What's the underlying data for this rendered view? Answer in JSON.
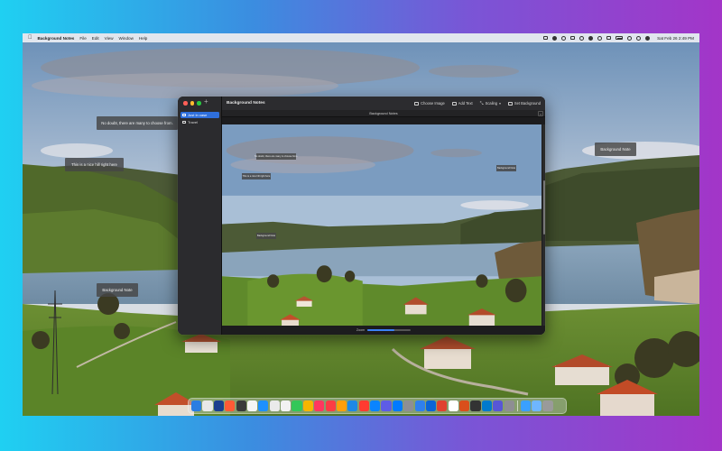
{
  "menubar": {
    "app_name": "Background Notes",
    "menus": [
      "File",
      "Edit",
      "View",
      "Window",
      "Help"
    ],
    "clock": "Sat Feb 26  2:49 PM"
  },
  "desktop_notes": [
    {
      "text": "No doubt, there are many to choose from."
    },
    {
      "text": "This is a nice hill right here"
    },
    {
      "text": "Background Note"
    },
    {
      "text": "Background Note"
    }
  ],
  "window": {
    "title": "Background Notes",
    "add_label": "+",
    "toolbar": {
      "choose_image": "Choose Image",
      "add_text": "Add Text",
      "scaling": "Scaling",
      "set_background": "Set Background"
    },
    "tab_title": "Background Notes",
    "tab_close": "×",
    "sidebar_items": [
      {
        "label": "Just In case",
        "active": true
      },
      {
        "label": "Travel",
        "active": false
      }
    ],
    "inner_notes": [
      {
        "text": "No doubt, there are many to choose from."
      },
      {
        "text": "This is a nice hill right here"
      },
      {
        "text": "Background Note"
      },
      {
        "text": "Background Note"
      }
    ],
    "zoom": {
      "label": "Zoom",
      "value": 0.62
    }
  },
  "dock": {
    "colors": [
      "#2a7de1",
      "#e8e8e8",
      "#1c3f8f",
      "#ff5a36",
      "#3a3a3a",
      "#f5f5f5",
      "#1e90ff",
      "#eaeaea",
      "#f2f2f2",
      "#34c759",
      "#f7b500",
      "#ff375f",
      "#fc3c44",
      "#ff9f0a",
      "#1e88e5",
      "#ff3b30",
      "#0a84ff",
      "#5e5ce6",
      "#007aff",
      "#8e8e93",
      "#2f80ed",
      "#0a64d6",
      "#e0412f",
      "#ffffff",
      "#d94f1c",
      "#333333",
      "#007acc",
      "#5856d6",
      "#8e8e93"
    ],
    "right_colors": [
      "#3aa0ff",
      "#6fb6ff",
      "#9a9a9a"
    ]
  },
  "colors": {
    "accent": "#2f6fdc",
    "bg_gradient_start": "#1fd0f2",
    "bg_gradient_end": "#a335c8"
  }
}
